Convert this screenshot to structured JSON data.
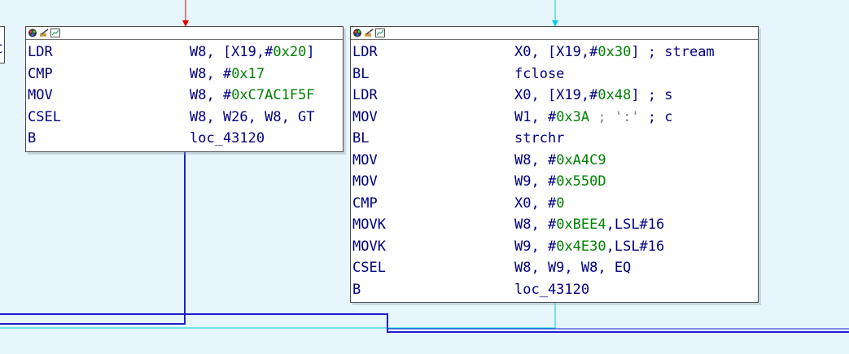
{
  "graph": {
    "left_stub_text": "C",
    "nodes": [
      {
        "id": "block-left",
        "lines": [
          {
            "mnemonic": "LDR",
            "operands": [
              {
                "t": "W8, [X19,#",
                "k": "op"
              },
              {
                "t": "0x20",
                "k": "num"
              },
              {
                "t": "]",
                "k": "op"
              }
            ]
          },
          {
            "mnemonic": "CMP",
            "operands": [
              {
                "t": "W8, #",
                "k": "op"
              },
              {
                "t": "0x17",
                "k": "num"
              }
            ]
          },
          {
            "mnemonic": "MOV",
            "operands": [
              {
                "t": "W8, #",
                "k": "op"
              },
              {
                "t": "0xC7AC1F5F",
                "k": "num"
              }
            ]
          },
          {
            "mnemonic": "CSEL",
            "operands": [
              {
                "t": "W8, W26, W8, GT",
                "k": "op"
              }
            ]
          },
          {
            "mnemonic": "B",
            "operands": [
              {
                "t": "loc_43120",
                "k": "op"
              }
            ]
          }
        ]
      },
      {
        "id": "block-right",
        "lines": [
          {
            "mnemonic": "LDR",
            "operands": [
              {
                "t": "X0, [X19,#",
                "k": "op"
              },
              {
                "t": "0x30",
                "k": "num"
              },
              {
                "t": "] ; stream",
                "k": "op"
              }
            ]
          },
          {
            "mnemonic": "BL",
            "operands": [
              {
                "t": "fclose",
                "k": "op"
              }
            ]
          },
          {
            "mnemonic": "LDR",
            "operands": [
              {
                "t": "X0, [X19,#",
                "k": "op"
              },
              {
                "t": "0x48",
                "k": "num"
              },
              {
                "t": "] ; s",
                "k": "op"
              }
            ]
          },
          {
            "mnemonic": "MOV",
            "operands": [
              {
                "t": "W1, #",
                "k": "op"
              },
              {
                "t": "0x3A",
                "k": "num"
              },
              {
                "t": " ; ':'",
                "k": "cmt"
              },
              {
                "t": " ; c",
                "k": "op"
              }
            ]
          },
          {
            "mnemonic": "BL",
            "operands": [
              {
                "t": "strchr",
                "k": "op"
              }
            ]
          },
          {
            "mnemonic": "MOV",
            "operands": [
              {
                "t": "W8, #",
                "k": "op"
              },
              {
                "t": "0xA4C9",
                "k": "num"
              }
            ]
          },
          {
            "mnemonic": "MOV",
            "operands": [
              {
                "t": "W9, #",
                "k": "op"
              },
              {
                "t": "0x550D",
                "k": "num"
              }
            ]
          },
          {
            "mnemonic": "CMP",
            "operands": [
              {
                "t": "X0, #",
                "k": "op"
              },
              {
                "t": "0",
                "k": "num"
              }
            ]
          },
          {
            "mnemonic": "MOVK",
            "operands": [
              {
                "t": "W8, #",
                "k": "op"
              },
              {
                "t": "0xBEE4",
                "k": "num"
              },
              {
                "t": ",LSL#16",
                "k": "op"
              }
            ]
          },
          {
            "mnemonic": "MOVK",
            "operands": [
              {
                "t": "W9, #",
                "k": "op"
              },
              {
                "t": "0x4E30",
                "k": "num"
              },
              {
                "t": ",LSL#16",
                "k": "op"
              }
            ]
          },
          {
            "mnemonic": "CSEL",
            "operands": [
              {
                "t": "W8, W9, W8, EQ",
                "k": "op"
              }
            ]
          },
          {
            "mnemonic": "B",
            "operands": [
              {
                "t": "loc_43120",
                "k": "op"
              }
            ]
          }
        ]
      }
    ],
    "colors": {
      "background": "#e6f6fc",
      "edge_unconditional": "#0000cc",
      "edge_taken": "#00d0e0",
      "edge_incoming_red": "#dd0000",
      "mnemonic": "#000080",
      "immediate": "#008000",
      "comment": "#808080"
    },
    "toolbar_icons": [
      "color-palette-icon",
      "edit-name-icon",
      "graph-view-icon"
    ]
  }
}
